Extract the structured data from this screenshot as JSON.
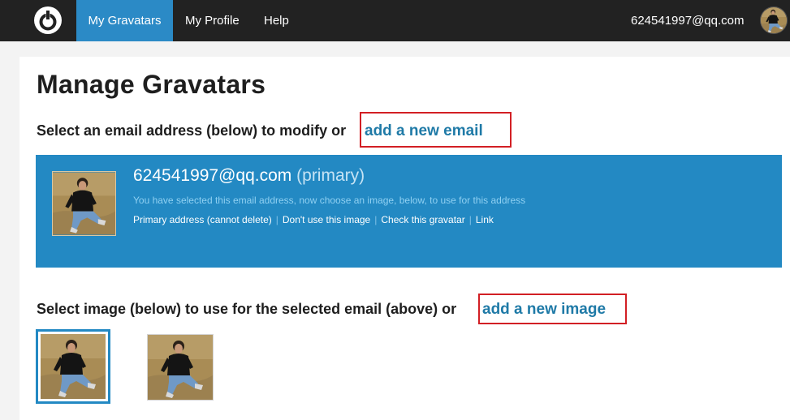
{
  "nav": {
    "logo_icon": "gravatar-power-logo-icon",
    "items": [
      {
        "label": "My Gravatars",
        "active": true
      },
      {
        "label": "My Profile",
        "active": false
      },
      {
        "label": "Help",
        "active": false
      }
    ],
    "user_email": "624541997@qq.com",
    "avatar_icon": "user-avatar-photo"
  },
  "page": {
    "title": "Manage Gravatars"
  },
  "emails_section": {
    "heading": "Select an email address (below) to modify or",
    "add_link": "add a new email"
  },
  "selected_email": {
    "address": "624541997@qq.com",
    "primary_tag": "(primary)",
    "hint": "You have selected this email address, now choose an image, below, to use for this address",
    "actions": [
      "Primary address (cannot delete)",
      "Don't use this image",
      "Check this gravatar",
      "Link"
    ]
  },
  "images_section": {
    "heading": "Select image (below) to use for the selected email (above) or",
    "add_link": "add a new image",
    "images": [
      {
        "name": "gravatar-photo-1",
        "selected": true
      },
      {
        "name": "gravatar-photo-2",
        "selected": false
      }
    ]
  },
  "colors": {
    "topbar": "#222222",
    "accent": "#2389c3",
    "link": "#1f7aa7",
    "highlight_box": "#d21f24"
  }
}
